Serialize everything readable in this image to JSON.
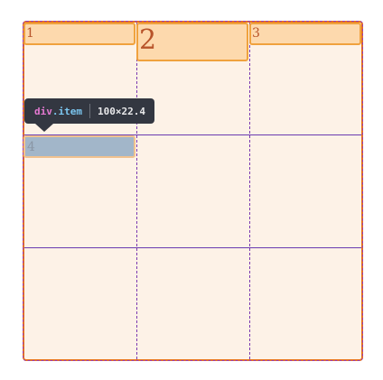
{
  "grid_items": [
    {
      "label": "1"
    },
    {
      "label": "2"
    },
    {
      "label": "3"
    },
    {
      "label": "4"
    }
  ],
  "tooltip": {
    "tag": "div",
    "class": ".item",
    "width": "100",
    "times": "×",
    "height": "22.4"
  },
  "colors": {
    "grid_background": "#fdf2e7",
    "grid_border": "#e8741c",
    "grid_lines": "#7b38b0",
    "item_background": "#fdd9ad",
    "item_border": "#f0a23e",
    "highlighted_item": "#a2b6c9",
    "tooltip_background": "#333741"
  }
}
